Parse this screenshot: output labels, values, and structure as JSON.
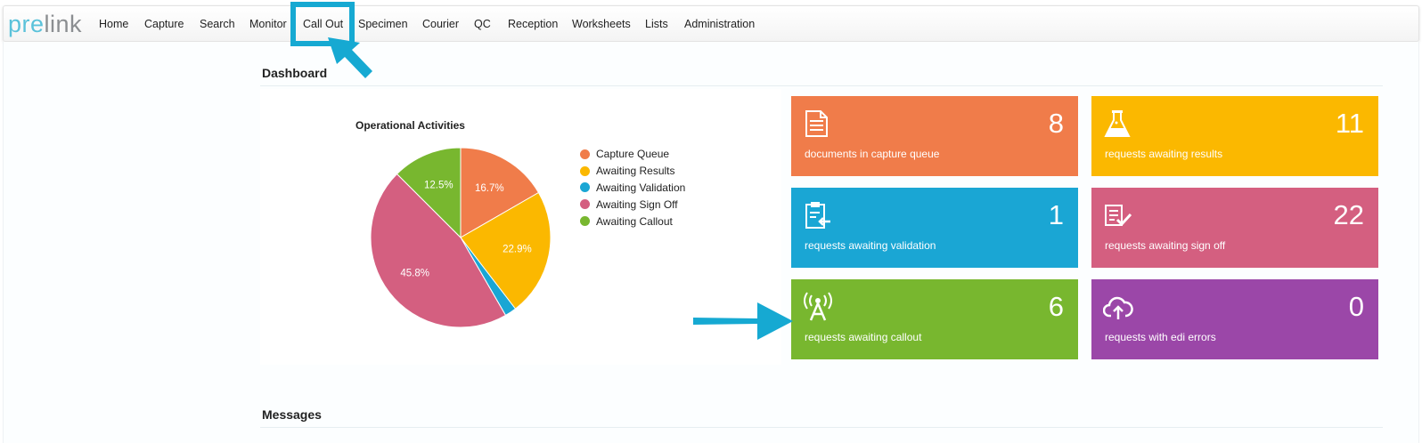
{
  "brand": {
    "part1": "pre",
    "part2": "link"
  },
  "nav": {
    "items": [
      "Home",
      "Capture",
      "Search",
      "Monitor",
      "Call Out",
      "Specimen",
      "Courier",
      "QC",
      "Reception",
      "Worksheets",
      "Lists",
      "Administration"
    ]
  },
  "dashboard": {
    "title": "Dashboard"
  },
  "messages": {
    "title": "Messages"
  },
  "chart_data": {
    "type": "pie",
    "title": "Operational Activities",
    "categories": [
      "Capture Queue",
      "Awaiting Results",
      "Awaiting Validation",
      "Awaiting Sign Off",
      "Awaiting Callout"
    ],
    "values": [
      8,
      11,
      1,
      22,
      6
    ],
    "data_labels": [
      "16.7%",
      "22.9%",
      "",
      "45.8%",
      "12.5%"
    ],
    "colors": [
      "#f07c4a",
      "#fbb800",
      "#1aa6d4",
      "#d45f80",
      "#78b72f"
    ],
    "legend": "right"
  },
  "tiles": [
    {
      "count": "8",
      "label": "documents in capture queue",
      "color": "#f07c4a",
      "icon": "document-icon"
    },
    {
      "count": "11",
      "label": "requests awaiting results",
      "color": "#fbb800",
      "icon": "flask-icon"
    },
    {
      "count": "1",
      "label": "requests awaiting validation",
      "color": "#1aa6d4",
      "icon": "clipboard-icon"
    },
    {
      "count": "22",
      "label": "requests awaiting sign off",
      "color": "#d45f80",
      "icon": "checklist-icon"
    },
    {
      "count": "6",
      "label": "requests awaiting callout",
      "color": "#78b72f",
      "icon": "antenna-icon"
    },
    {
      "count": "0",
      "label": "requests with edi errors",
      "color": "#9b47a8",
      "icon": "cloud-upload-icon"
    }
  ],
  "annotation": {
    "color": "#16a9d2"
  }
}
